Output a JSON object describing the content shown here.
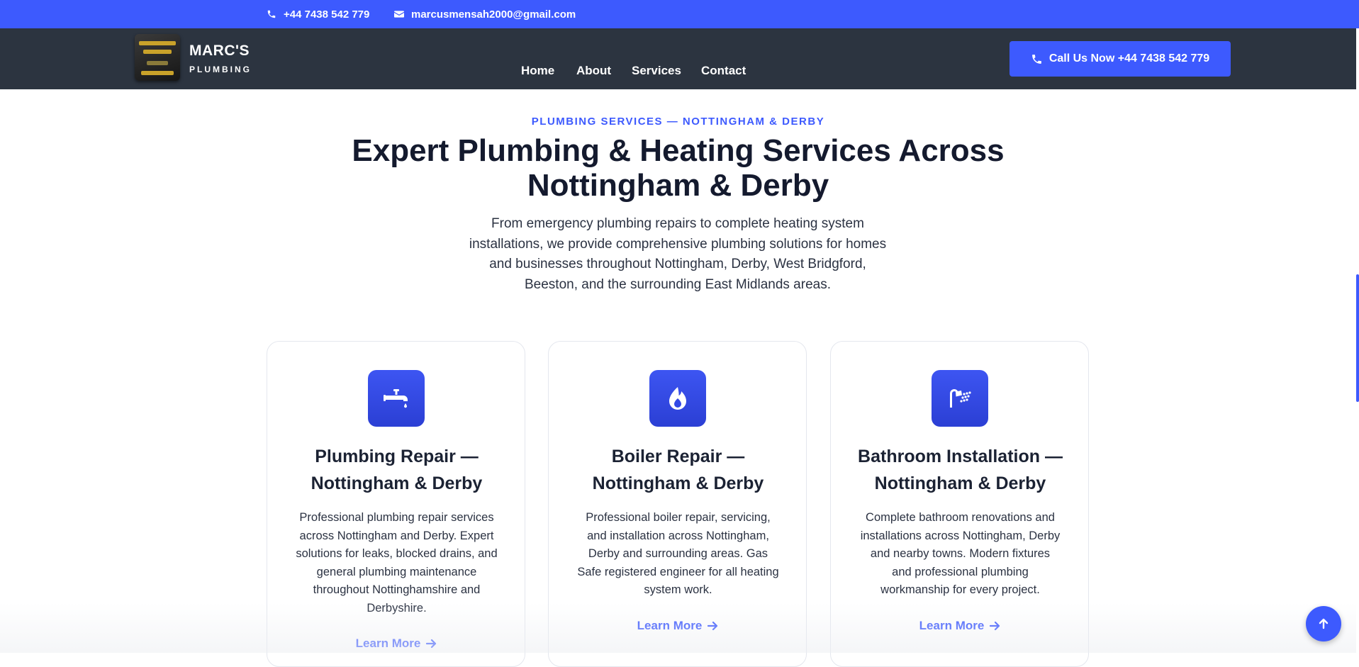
{
  "topbar": {
    "phone": "+44 7438 542 779",
    "email": "marcusmensah2000@gmail.com"
  },
  "brand": {
    "name": "MARC'S",
    "sub": "PLUMBING"
  },
  "nav": {
    "items": [
      {
        "label": "Home"
      },
      {
        "label": "About"
      },
      {
        "label": "Services"
      },
      {
        "label": "Contact"
      }
    ],
    "cta_label": "Call Us Now +44 7438 542 779"
  },
  "hero": {
    "eyebrow": "PLUMBING SERVICES — NOTTINGHAM & DERBY",
    "title": "Expert Plumbing & Heating Services Across Nottingham & Derby",
    "intro": "From emergency plumbing repairs to complete heating system installations, we provide comprehensive plumbing solutions for homes and businesses throughout Nottingham, Derby, West Bridgford, Beeston, and the surrounding East Midlands areas."
  },
  "services": [
    {
      "icon": "faucet-icon",
      "title": "Plumbing Repair — Nottingham & Derby",
      "desc": "Professional plumbing repair services across Nottingham and Derby. Expert solutions for leaks, blocked drains, and general plumbing maintenance throughout Nottinghamshire and Derbyshire.",
      "link": "Learn More"
    },
    {
      "icon": "fire-icon",
      "title": "Boiler Repair — Nottingham & Derby",
      "desc": "Professional boiler repair, servicing, and installation across Nottingham, Derby and surrounding areas. Gas Safe registered engineer for all heating system work.",
      "link": "Learn More"
    },
    {
      "icon": "shower-icon",
      "title": "Bathroom Installation — Nottingham & Derby",
      "desc": "Complete bathroom renovations and installations across Nottingham, Derby and nearby towns. Modern fixtures and professional plumbing workmanship for every project.",
      "link": "Learn More"
    }
  ],
  "colors": {
    "accent": "#3d5afe",
    "nav_bg": "#2c3440",
    "heading": "#141a2e"
  }
}
